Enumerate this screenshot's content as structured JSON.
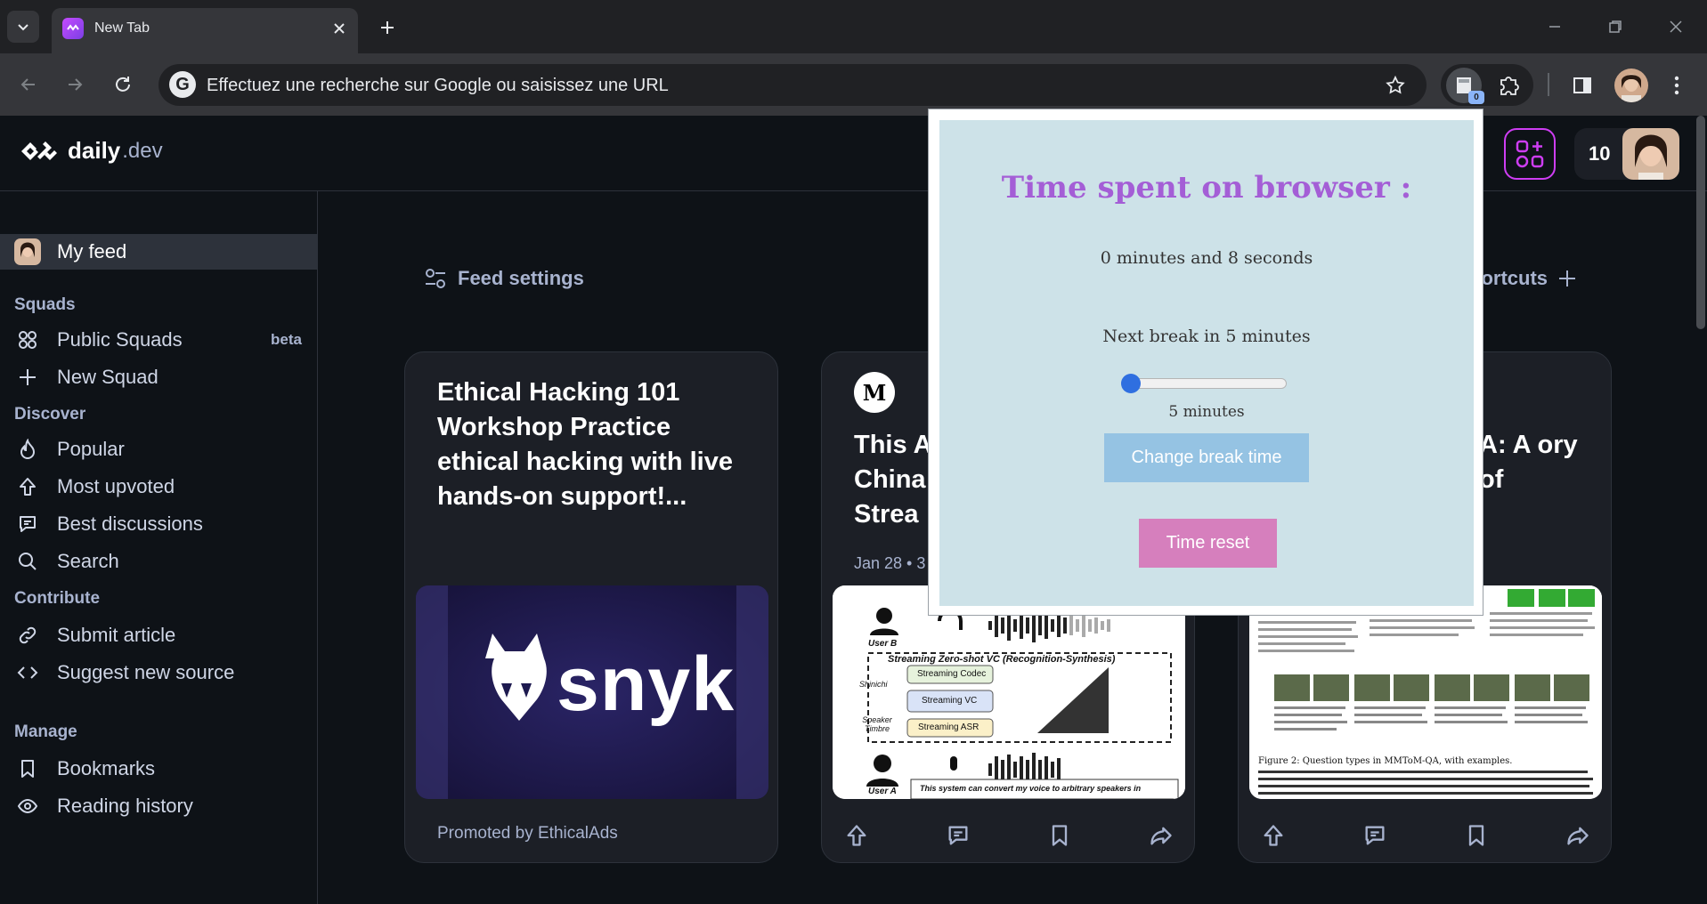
{
  "browser": {
    "tab_title": "New Tab",
    "omnibox_placeholder": "Effectuez une recherche sur Google ou saisissez une URL",
    "extension_badge": "0"
  },
  "header": {
    "logo_main": "daily",
    "logo_suffix": ".dev",
    "reputation": "10"
  },
  "sidebar": {
    "my_feed": "My feed",
    "squads_heading": "Squads",
    "public_squads": "Public Squads",
    "beta": "beta",
    "new_squad": "New Squad",
    "discover_heading": "Discover",
    "popular": "Popular",
    "most_upvoted": "Most upvoted",
    "best_discussions": "Best discussions",
    "search": "Search",
    "contribute_heading": "Contribute",
    "submit_article": "Submit article",
    "suggest_source": "Suggest new source",
    "manage_heading": "Manage",
    "bookmarks": "Bookmarks",
    "reading_history": "Reading history"
  },
  "feed": {
    "feed_settings": "Feed settings",
    "shortcuts": "hortcuts",
    "cards": [
      {
        "title": "Ethical Hacking 101 Workshop Practice ethical hacking with live hands-on support!...",
        "promo": "Promoted by EthicalAds",
        "image_brand": "snyk"
      },
      {
        "source_letter": "M",
        "title": "This A China Strea",
        "meta": "Jan 28 • 3",
        "figure_caption": "Streaming Zero-shot VC (Recognition-Synthesis)",
        "figure_labels": [
          "Streaming Codec",
          "Streaming VC",
          "Streaming ASR",
          "User B",
          "User A",
          "Shinichi",
          "Speaker Timbre"
        ],
        "figure_footer": "This system can convert my voice to arbitrary speakers in"
      },
      {
        "title": "A: A ory of",
        "figure_caption": "Figure 2: Question types in MMToM-QA, with examples."
      }
    ]
  },
  "popup": {
    "title": "Time spent on browser :",
    "elapsed": "0 minutes and 8 seconds",
    "next_break": "Next break in 5 minutes",
    "slider_value": 5,
    "slider_label": "5 minutes",
    "change_button": "Change break time",
    "reset_button": "Time reset",
    "title_color": "#a45ed6",
    "change_color": "#95c3e3",
    "reset_color": "#d67fbd"
  }
}
